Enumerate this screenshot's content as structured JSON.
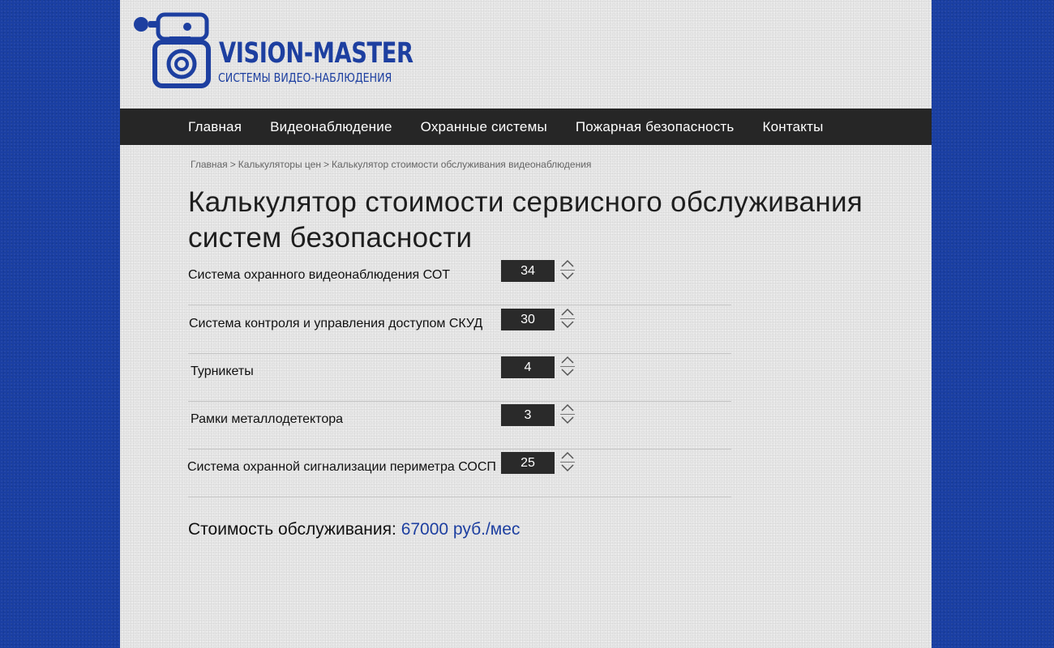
{
  "brand": {
    "name": "VISION-MASTER",
    "subtitle": "СИСТЕМЫ ВИДЕО-НАБЛЮДЕНИЯ",
    "color": "#1d3fa0"
  },
  "nav": {
    "items": [
      {
        "label": "Главная"
      },
      {
        "label": "Видеонаблюдение"
      },
      {
        "label": "Охранные системы"
      },
      {
        "label": "Пожарная безопасность"
      },
      {
        "label": "Контакты"
      }
    ]
  },
  "breadcrumb": {
    "items": [
      "Главная",
      "Калькуляторы цен",
      "Калькулятор стоимости обслуживания видеонаблюдения"
    ],
    "separator": ">"
  },
  "page": {
    "title": "Калькулятор стоимости сервисного обслуживания систем безопасности"
  },
  "calculator": {
    "rows": [
      {
        "label": "Система охранного видеонаблюдения СОТ",
        "value": "34"
      },
      {
        "label": "Система контроля и управления доступом СКУД",
        "value": "30"
      },
      {
        "label": "Турникеты",
        "value": "4"
      },
      {
        "label": "Рамки металлодетектора",
        "value": "3"
      },
      {
        "label": "Система охранной сигнализации периметра СОСП",
        "value": "25"
      }
    ]
  },
  "total": {
    "label": "Стоимость обслуживания:",
    "amount": "67000 руб./мес"
  }
}
